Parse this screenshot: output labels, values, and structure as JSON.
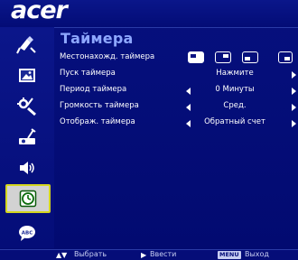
{
  "brand": {
    "logo": "acer"
  },
  "menu": {
    "title": "Таймера",
    "selected_tab": "timer",
    "tabs": [
      {
        "icon": "color-adjust-icon"
      },
      {
        "icon": "image-settings-icon"
      },
      {
        "icon": "management-settings-icon"
      },
      {
        "icon": "projector-settings-icon"
      },
      {
        "icon": "audio-icon"
      },
      {
        "icon": "timer-icon"
      },
      {
        "icon": "language-icon"
      }
    ],
    "rows": [
      {
        "label": "Местонахожд. таймера",
        "value": ""
      },
      {
        "label": "Пуск таймера",
        "value": "Нажмите"
      },
      {
        "label": "Период таймера",
        "value": "0  Минуты"
      },
      {
        "label": "Громкость таймера",
        "value": "Сред."
      },
      {
        "label": "Отображ. таймера",
        "value": "Обратный счет"
      }
    ]
  },
  "footer": {
    "select_label": "Выбрать",
    "enter_label": "Ввести",
    "menu_key": "MENU",
    "exit_label": "Выход"
  },
  "colors": {
    "background": "#020b7a",
    "title": "#8ea7ff",
    "selection_border": "#d4d61e"
  }
}
